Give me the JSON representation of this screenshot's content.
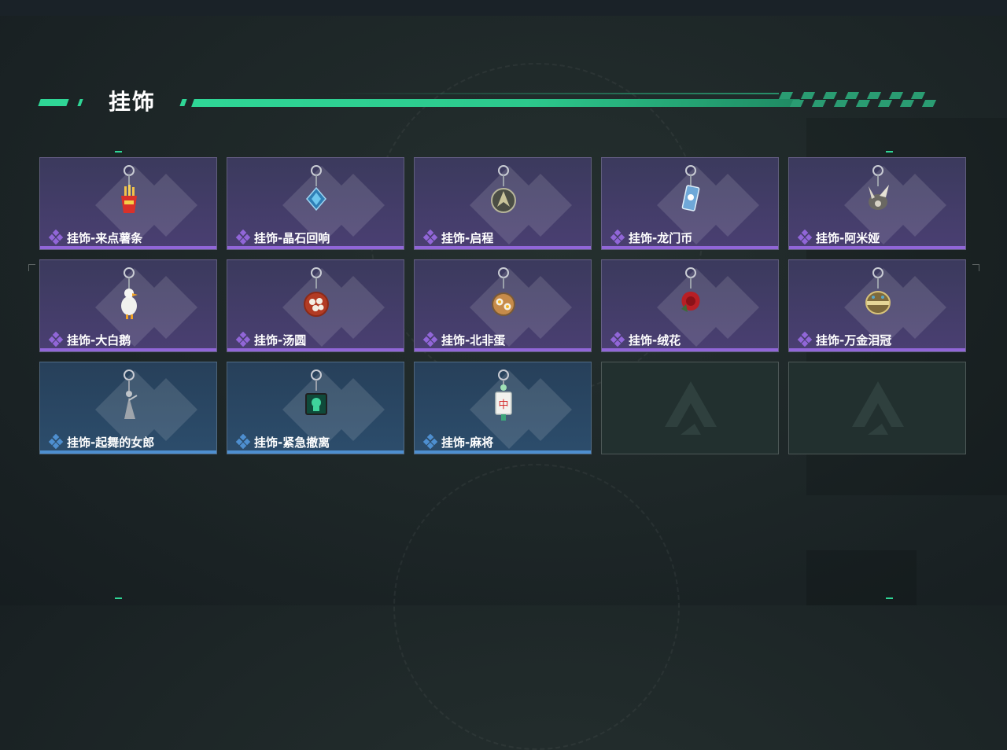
{
  "header": {
    "title": "挂饰"
  },
  "colors": {
    "accent": "#2fd696",
    "epic": "#9166d8",
    "rare": "#4e8fd0"
  },
  "items": [
    {
      "name": "挂饰-来点薯条",
      "rarity": "epic",
      "icon": "french-fries-charm-icon"
    },
    {
      "name": "挂饰-晶石回响",
      "rarity": "epic",
      "icon": "crystal-charm-icon"
    },
    {
      "name": "挂饰-启程",
      "rarity": "epic",
      "icon": "emblem-charm-icon"
    },
    {
      "name": "挂饰-龙门币",
      "rarity": "epic",
      "icon": "coin-card-charm-icon"
    },
    {
      "name": "挂饰-阿米娅",
      "rarity": "epic",
      "icon": "bunny-charm-icon"
    },
    {
      "name": "挂饰-大白鹅",
      "rarity": "epic",
      "icon": "goose-charm-icon"
    },
    {
      "name": "挂饰-汤圆",
      "rarity": "epic",
      "icon": "dumpling-bowl-charm-icon"
    },
    {
      "name": "挂饰-北非蛋",
      "rarity": "epic",
      "icon": "shakshuka-charm-icon"
    },
    {
      "name": "挂饰-绒花",
      "rarity": "epic",
      "icon": "red-flower-charm-icon"
    },
    {
      "name": "挂饰-万金泪冠",
      "rarity": "epic",
      "icon": "crown-charm-icon"
    },
    {
      "name": "挂饰-起舞的女郎",
      "rarity": "rare",
      "icon": "dancer-charm-icon"
    },
    {
      "name": "挂饰-紧急撤离",
      "rarity": "rare",
      "icon": "escape-charm-icon"
    },
    {
      "name": "挂饰-麻将",
      "rarity": "rare",
      "icon": "mahjong-charm-icon"
    }
  ],
  "empty_slots": 2
}
